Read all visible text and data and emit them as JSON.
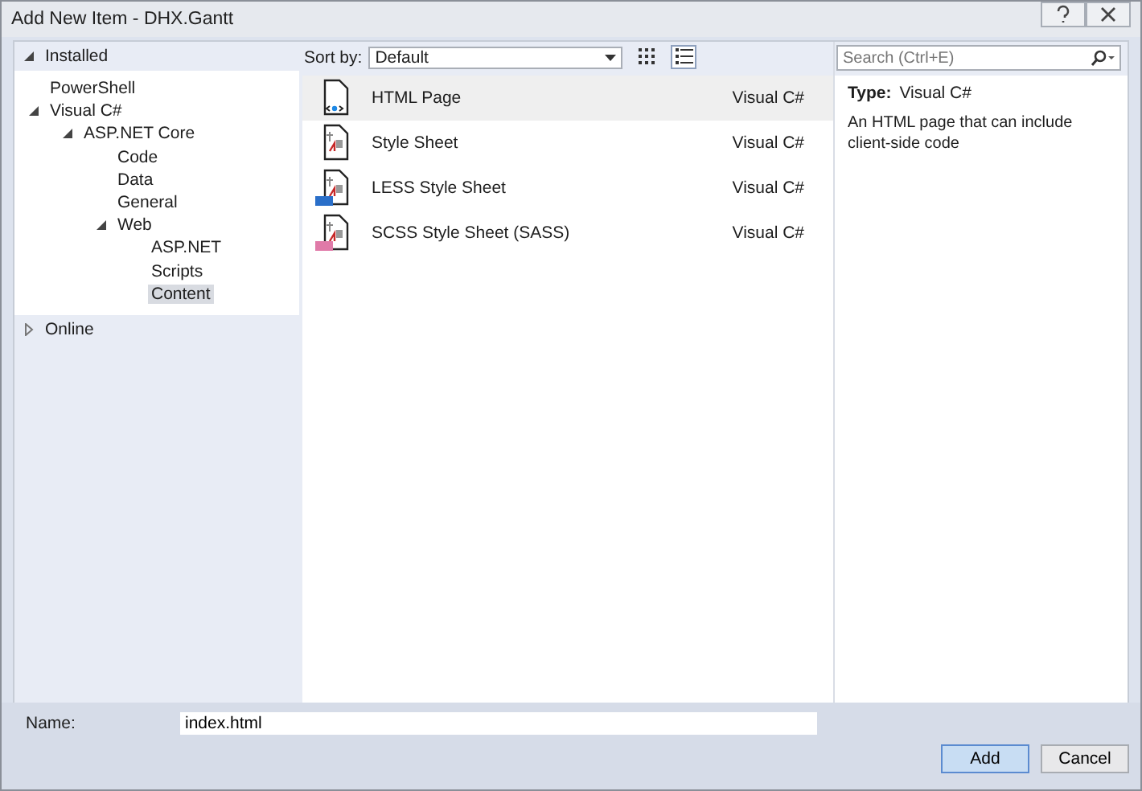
{
  "window": {
    "title": "Add New Item - DHX.Gantt"
  },
  "sections": [
    {
      "label": "Installed",
      "expanded": true,
      "children": [
        {
          "label": "PowerShell",
          "selected": false
        },
        {
          "label": "Visual C#",
          "selected": false,
          "expanded": true,
          "children": [
            {
              "label": "ASP.NET Core",
              "selected": false,
              "expanded": true,
              "children": [
                {
                  "label": "Code",
                  "selected": false
                },
                {
                  "label": "Data",
                  "selected": false
                },
                {
                  "label": "General",
                  "selected": false
                },
                {
                  "label": "Web",
                  "selected": false,
                  "expanded": true,
                  "children": [
                    {
                      "label": "ASP.NET",
                      "selected": false
                    },
                    {
                      "label": "Scripts",
                      "selected": false
                    },
                    {
                      "label": "Content",
                      "selected": true
                    }
                  ]
                }
              ]
            }
          ]
        }
      ]
    },
    {
      "label": "Online",
      "expanded": false
    }
  ],
  "toolbar": {
    "sort_label": "Sort by:",
    "sort_value": "Default",
    "view_buttons": [
      {
        "kind": "grid",
        "selected": false
      },
      {
        "kind": "list",
        "selected": true
      }
    ]
  },
  "search": {
    "placeholder": "Search (Ctrl+E)"
  },
  "templates": [
    {
      "kind": "html",
      "name": "HTML Page",
      "language": "Visual C#",
      "selected": true
    },
    {
      "kind": "css",
      "name": "Style Sheet",
      "language": "Visual C#",
      "selected": false
    },
    {
      "kind": "less",
      "name": "LESS Style Sheet",
      "language": "Visual C#",
      "selected": false
    },
    {
      "kind": "scss",
      "name": "SCSS Style Sheet (SASS)",
      "language": "Visual C#",
      "selected": false
    }
  ],
  "details": {
    "type_label": "Type:",
    "type_value": "Visual C#",
    "description": "An HTML page that can include client-side code"
  },
  "name_field": {
    "label": "Name:",
    "value": "index.html"
  },
  "buttons": [
    {
      "label": "Add",
      "default": true
    },
    {
      "label": "Cancel",
      "default": false
    }
  ]
}
